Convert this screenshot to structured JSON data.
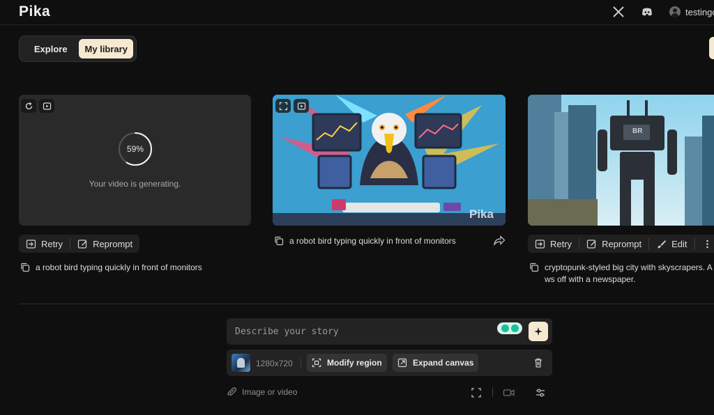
{
  "app": {
    "logo": "Pika"
  },
  "header": {
    "user_name": "testingc",
    "icons": [
      "x-logo-icon",
      "discord-icon",
      "user-avatar-icon"
    ]
  },
  "tabs": [
    {
      "label": "Explore",
      "active": false
    },
    {
      "label": "My library",
      "active": true
    }
  ],
  "cards": [
    {
      "status": "generating",
      "progress_text": "59%",
      "progress_value": 0.59,
      "generating_text": "Your video is generating.",
      "actions": [
        "Retry",
        "Reprompt"
      ],
      "caption": "a robot bird typing quickly in front of monitors"
    },
    {
      "status": "done",
      "watermark": "Pika",
      "caption": "a robot bird typing quickly in front of monitors"
    },
    {
      "status": "done",
      "robot_chest_text": "BR",
      "actions": [
        "Retry",
        "Reprompt",
        "Edit"
      ],
      "caption_line1": "cryptopunk-styled big city with skyscrapers. A",
      "caption_line2": "ws off with a newspaper."
    }
  ],
  "composer": {
    "placeholder": "Describe your story",
    "resolution": "1280x720",
    "modify_region": "Modify region",
    "expand_canvas": "Expand canvas",
    "attach_label": "Image or video"
  },
  "colors": {
    "accent": "#f7e9d1",
    "background": "#0f0f0f",
    "surface": "#232323"
  }
}
